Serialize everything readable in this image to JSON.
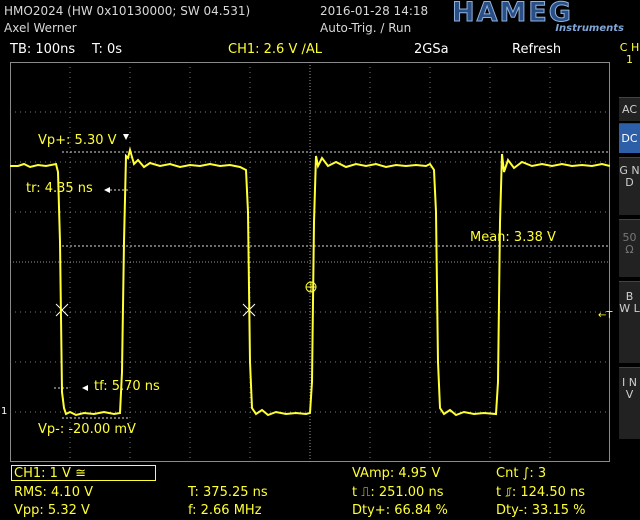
{
  "header": {
    "model": "HMO2024 (HW 0x10130000; SW 04.531)",
    "owner": "Axel Werner",
    "datetime": "2016-01-28 14:18",
    "trigger_mode": "Auto-Trig. / Run",
    "brand": "HAMEG",
    "brand_sub": "Instruments"
  },
  "status": {
    "timebase": "TB: 100ns",
    "time_offset": "T: 0s",
    "channel_setting": "CH1: 2.6 V ∕AL",
    "sample_rate": "2GSa",
    "acq_mode": "Refresh"
  },
  "sidebar": {
    "channel_label": "C H 1",
    "buttons": [
      "AC",
      "DC",
      "G N D",
      "50 Ω",
      "B W L",
      "I N V"
    ]
  },
  "measurements": {
    "vp_plus": "Vp+: 5.30 V",
    "tr": "tr: 4.35 ns",
    "mean": "Mean: 3.38 V",
    "tf": "tf: 5.70 ns",
    "vp_minus": "Vp-: -20.00 mV",
    "trigger_marker": "←T",
    "ground_marker": "1"
  },
  "bottom": {
    "channel": "CH1: 1 V ≅",
    "vamp": "VAmp: 4.95 V",
    "cnt": "Cnt ∫: 3",
    "rms": "RMS: 4.10 V",
    "period": "T: 375.25 ns",
    "t_pos": "t ⎍: 251.00 ns",
    "t_neg": "t ⎎: 124.50 ns",
    "vpp": "Vpp: 5.32 V",
    "freq": "f: 2.66 MHz",
    "dty_plus": "Dty+: 66.84 %",
    "dty_minus": "Dty-: 33.15 %"
  },
  "colors": {
    "trace": "#ffff33",
    "grid": "#8a8a8a",
    "brand": "#2a4f86",
    "active_button": "#2d5fa8"
  }
}
